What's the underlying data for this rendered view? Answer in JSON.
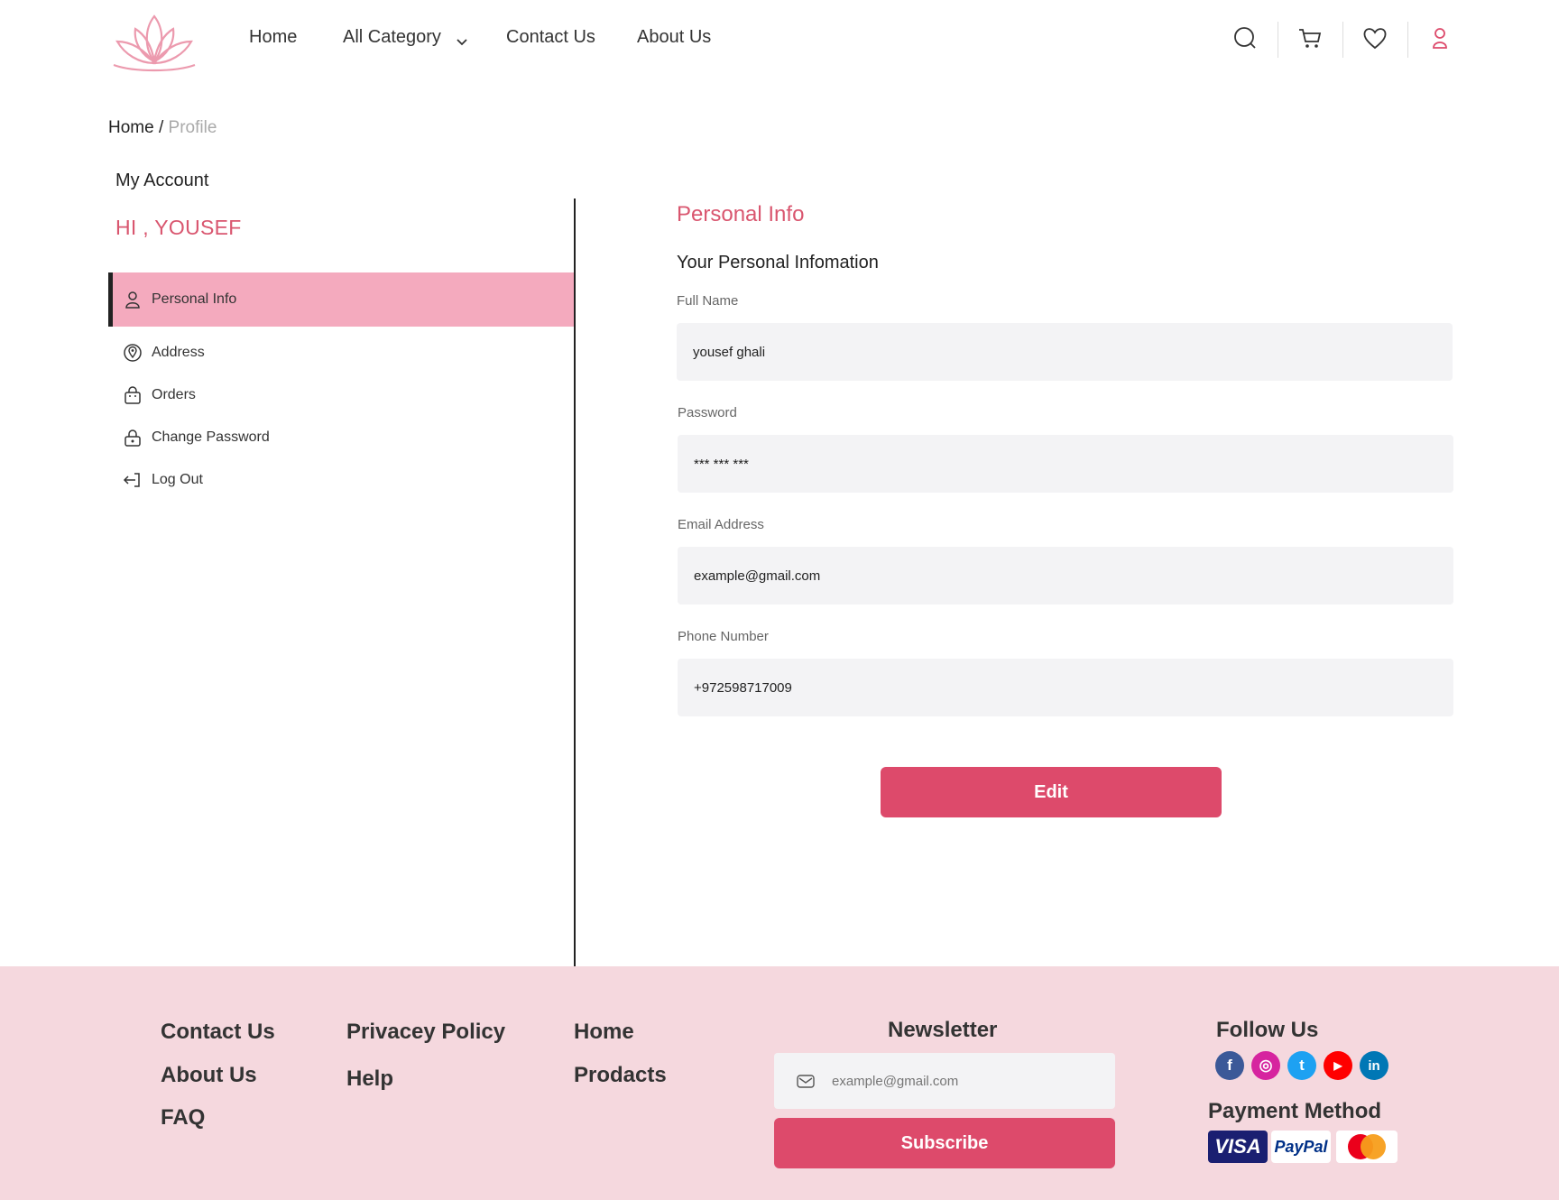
{
  "header": {
    "nav": [
      {
        "label": "Home"
      },
      {
        "label": "All Category"
      },
      {
        "label": "Contact Us"
      },
      {
        "label": "About Us"
      }
    ],
    "icons": [
      "search-icon",
      "cart-icon",
      "heart-icon",
      "user-icon"
    ]
  },
  "breadcrumb": {
    "root": "Home",
    "separator": " / ",
    "current": "Profile"
  },
  "sidebar": {
    "title": "My Account",
    "greeting": "HI , YOUSEF",
    "items": [
      {
        "label": "Personal Info",
        "icon": "user-icon",
        "active": true
      },
      {
        "label": "Address",
        "icon": "location-pin-icon",
        "active": false
      },
      {
        "label": "Orders",
        "icon": "shopping-bag-icon",
        "active": false
      },
      {
        "label": "Change Password",
        "icon": "lock-icon",
        "active": false
      },
      {
        "label": "Log Out",
        "icon": "logout-icon",
        "active": false
      }
    ]
  },
  "main": {
    "title": "Personal Info",
    "subtitle": "Your Personal Infomation",
    "fields": [
      {
        "label": "Full Name",
        "value": "yousef ghali"
      },
      {
        "label": "Password",
        "value": "*** *** ***"
      },
      {
        "label": "Email Address",
        "value": "example@gmail.com"
      },
      {
        "label": "Phone Number",
        "value": "+972598717009"
      }
    ],
    "edit_label": "Edit"
  },
  "footer": {
    "col1": [
      "Contact Us",
      "About Us",
      "FAQ"
    ],
    "col2": [
      "Privacey Policy",
      "Help"
    ],
    "col3": [
      "Home",
      "Prodacts"
    ],
    "newsletter": {
      "title": "Newsletter",
      "placeholder": "example@gmail.com",
      "subscribe_label": "Subscribe"
    },
    "follow_title": "Follow Us",
    "social": [
      {
        "name": "facebook-icon",
        "glyph": "f",
        "color": "#3b5998"
      },
      {
        "name": "instagram-icon",
        "glyph": "◎",
        "color": "#d6249f"
      },
      {
        "name": "twitter-icon",
        "glyph": "t",
        "color": "#1da1f2"
      },
      {
        "name": "youtube-icon",
        "glyph": "▶",
        "color": "#ff0000"
      },
      {
        "name": "linkedin-icon",
        "glyph": "in",
        "color": "#0077b5"
      }
    ],
    "payment_title": "Payment Method",
    "payments": {
      "visa": "VISA",
      "paypal": "PayPal"
    }
  },
  "colors": {
    "accent": "#dd4a6b",
    "accent_soft": "#f4aabe",
    "footer_bg": "#f5d8de"
  }
}
